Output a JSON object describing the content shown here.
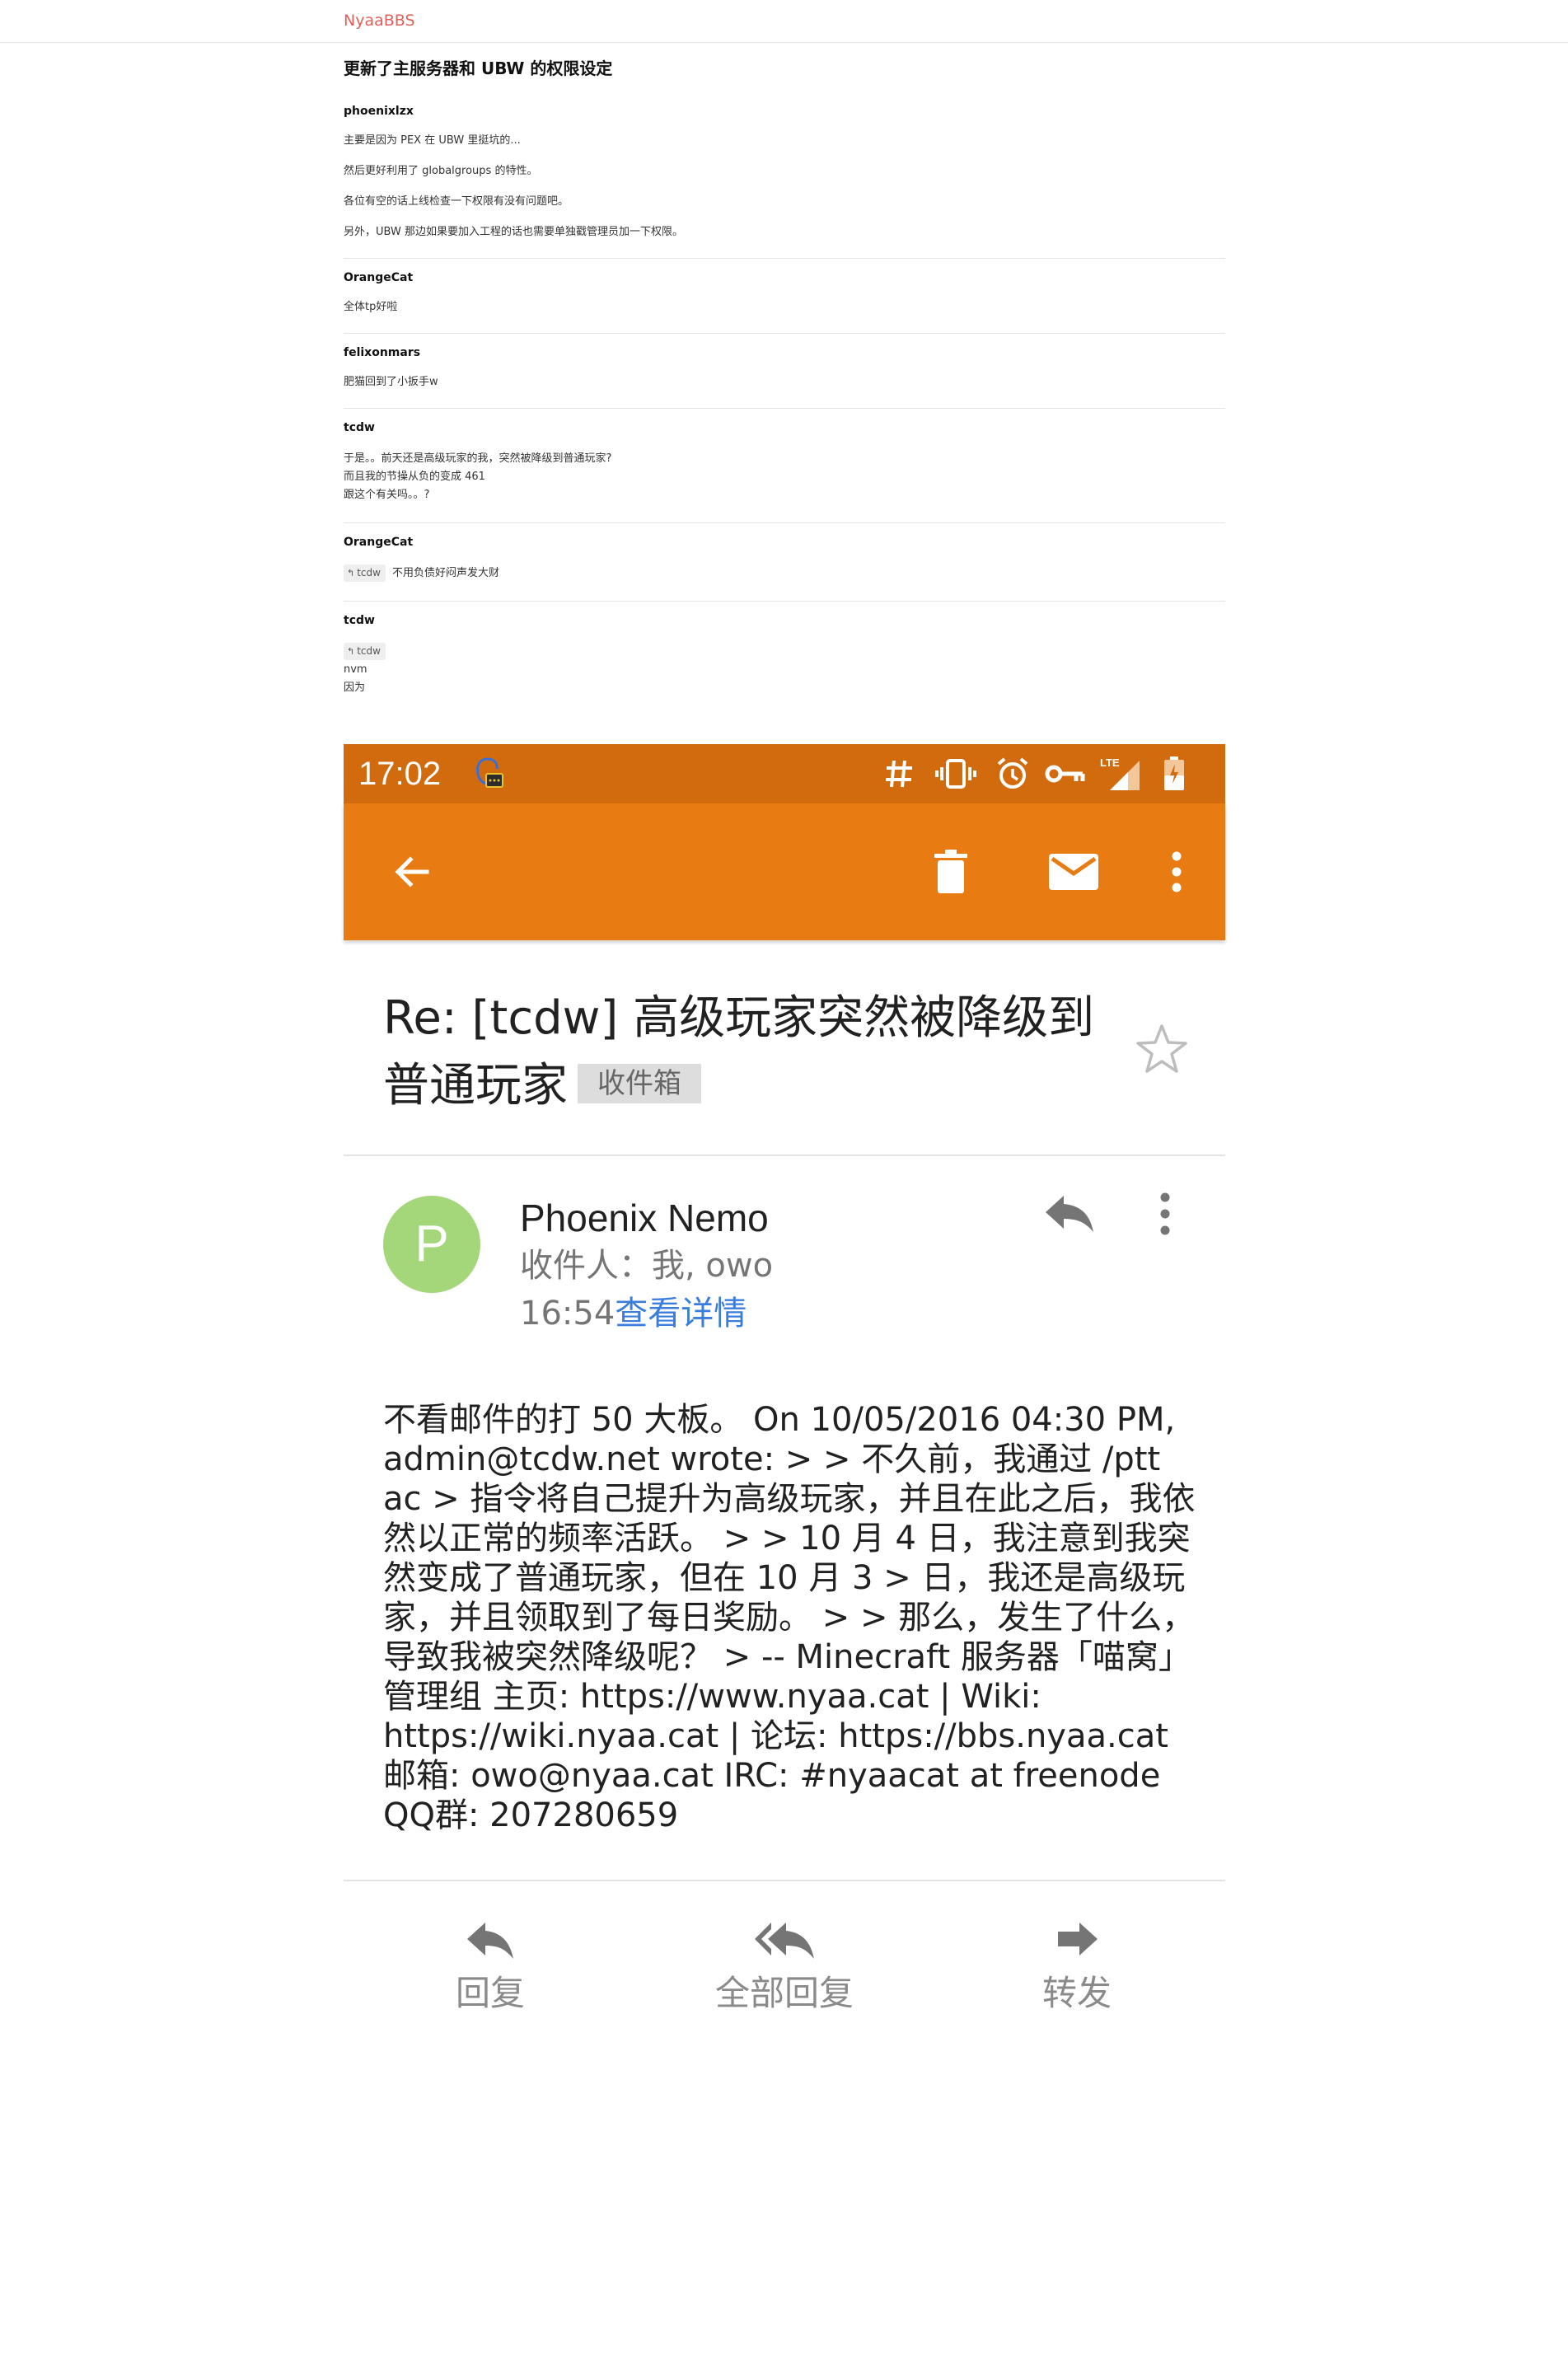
{
  "site": {
    "brand": "NyaaBBS"
  },
  "thread": {
    "title": "更新了主服务器和 UBW 的权限设定",
    "posts": [
      {
        "author": "phoenixlzx",
        "paragraphs": [
          "主要是因为 PEX 在 UBW 里挺坑的...",
          "然后更好利用了 globalgroups 的特性。",
          "各位有空的话上线检查一下权限有没有问题吧。",
          "另外，UBW 那边如果要加入工程的话也需要单独戳管理员加一下权限。"
        ]
      },
      {
        "author": "OrangeCat",
        "paragraphs": [
          "全体tp好啦"
        ]
      },
      {
        "author": "felixonmars",
        "paragraphs": [
          "肥猫回到了小扳手w"
        ]
      },
      {
        "author": "tcdw",
        "lines": [
          "于是。。前天还是高级玩家的我，突然被降级到普通玩家?",
          "而且我的节操从负的变成 461",
          "跟这个有关吗。。?"
        ]
      },
      {
        "author": "OrangeCat",
        "reply_to": "tcdw",
        "text": "不用负债好闷声发大财"
      },
      {
        "author": "tcdw",
        "reply_to": "tcdw",
        "lines": [
          "nvm",
          "因为"
        ]
      }
    ]
  },
  "phone": {
    "status_bar": {
      "time": "17:02",
      "icons": [
        "chat-head-icon",
        "hash-icon",
        "vibrate-icon",
        "alarm-icon",
        "vpn-key-icon",
        "lte-signal-icon",
        "battery-icon"
      ],
      "network": "LTE"
    },
    "toolbar": {
      "icons": [
        "back-arrow-icon",
        "delete-icon",
        "mail-icon",
        "more-vert-icon"
      ]
    },
    "email": {
      "subject": "Re: [tcdw] 高级玩家突然被降级到普通玩家",
      "label": "收件箱",
      "sender_initial": "P",
      "sender_name": "Phoenix Nemo",
      "recipients": "收件人：我, owo",
      "time": "16:54",
      "details_link": "查看详情",
      "body": "不看邮件的打 50 大板。 On 10/05/2016 04:30 PM, admin@tcdw.net wrote: > > 不久前，我通过 /ptt ac > 指令将自己提升为高级玩家，并且在此之后，我依然以正常的频率活跃。 > > 10 月 4 日，我注意到我突然变成了普通玩家，但在 10 月 3 > 日，我还是高级玩家，并且领取到了每日奖励。 > > 那么，发生了什么，导致我被突然降级呢？ > -- Minecraft 服务器「喵窝」管理组 主页: https://www.nyaa.cat | Wiki: https://wiki.nyaa.cat | 论坛: https://bbs.nyaa.cat 邮箱: owo@nyaa.cat IRC: #nyaacat at freenode QQ群: 207280659"
    },
    "actions": [
      {
        "label": "回复",
        "icon": "reply-icon"
      },
      {
        "label": "全部回复",
        "icon": "reply-all-icon"
      },
      {
        "label": "转发",
        "icon": "forward-icon"
      }
    ],
    "colors": {
      "status_bar": "#d16b0e",
      "app_bar": "#e87c12",
      "avatar": "#a4d67a",
      "link": "#3b7ddd",
      "brand": "#e0605c"
    }
  }
}
